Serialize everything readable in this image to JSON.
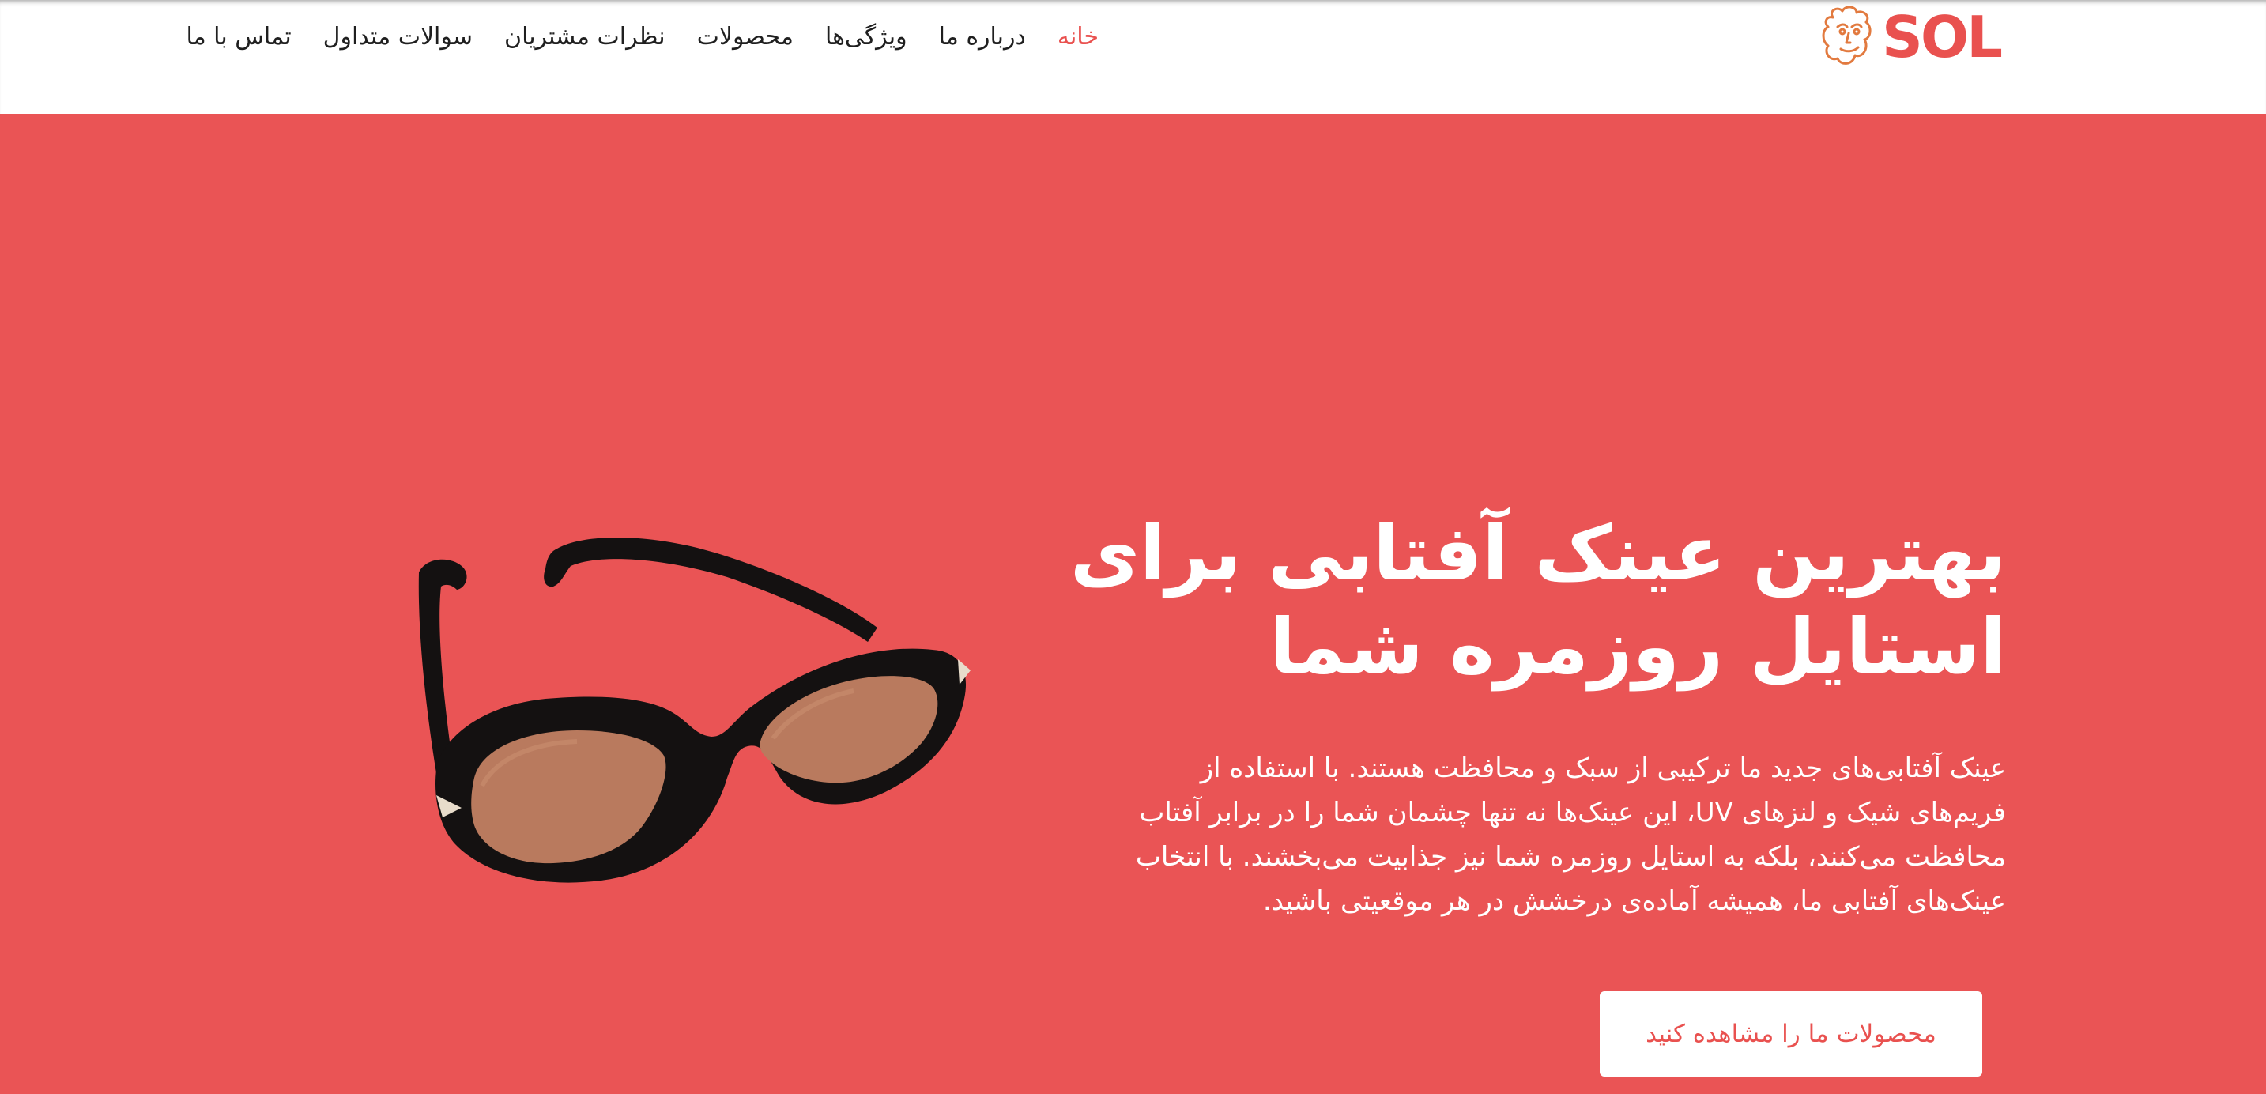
{
  "brand": {
    "logo_text": "SOL",
    "logo_icon": "sun-face-icon",
    "accent_color": "#e9514f"
  },
  "nav": {
    "items": [
      {
        "label": "خانه",
        "active": true
      },
      {
        "label": "درباره ما",
        "active": false
      },
      {
        "label": "ویژگی‌ها",
        "active": false
      },
      {
        "label": "محصولات",
        "active": false
      },
      {
        "label": "نظرات مشتریان",
        "active": false
      },
      {
        "label": "سوالات متداول",
        "active": false
      },
      {
        "label": "تماس با ما",
        "active": false
      }
    ]
  },
  "hero": {
    "background_color": "#ea5455",
    "title": "بهترین عینک آفتابی برای استایل روزمره شما",
    "description": "عینک آفتابی‌های جدید ما ترکیبی از سبک و محافظت هستند. با استفاده از فریم‌های شیک و لنزهای UV، این عینک‌ها نه تنها چشمان شما را در برابر آفتاب محافظت می‌کنند، بلکه به استایل روزمره شما نیز جذابیت می‌بخشند. با انتخاب عینک‌های آفتابی ما، همیشه آماده‌ی درخشش در هر موقعیتی باشید.",
    "cta_label": "محصولات ما را مشاهده کنید",
    "image": "sunglasses-product-image"
  }
}
